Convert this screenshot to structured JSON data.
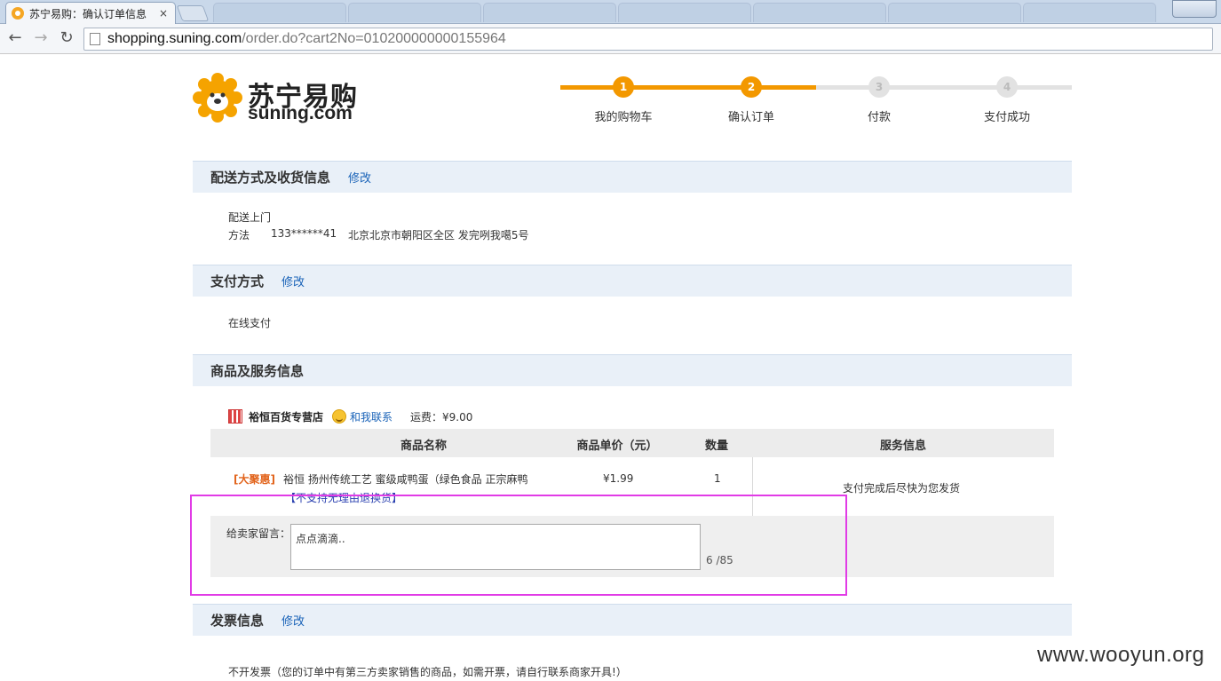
{
  "browser": {
    "tab_title": "苏宁易购：确认订单信息",
    "tab_close": "×",
    "url_host": "shopping.suning.com",
    "url_path": "/order.do?cart2No=010200000000155964",
    "back_glyph": "←",
    "forward_glyph": "→",
    "reload_glyph": "↻"
  },
  "logo": {
    "cn": "苏宁易购",
    "en": "suning.com"
  },
  "steps": [
    {
      "num": "1",
      "label": "我的购物车",
      "active": true
    },
    {
      "num": "2",
      "label": "确认订单",
      "active": true
    },
    {
      "num": "3",
      "label": "付款",
      "active": false
    },
    {
      "num": "4",
      "label": "支付成功",
      "active": false
    }
  ],
  "colors": {
    "accent": "#f39800",
    "inactive": "#e2e2e2",
    "link": "#1a63b8",
    "highlight": "#e13be6"
  },
  "delivery": {
    "title": "配送方式及收货信息",
    "edit": "修改",
    "method": "配送上门",
    "name": "方法",
    "phone": "133******41",
    "address": "北京北京市朝阳区全区  发完咧我噶5号"
  },
  "payment": {
    "title": "支付方式",
    "edit": "修改",
    "method": "在线支付"
  },
  "goods": {
    "title": "商品及服务信息",
    "store_name": "裕恒百货专营店",
    "contact": "和我联系",
    "shipping": "运费：¥9.00",
    "headers": {
      "name": "商品名称",
      "price": "商品单价（元）",
      "qty": "数量",
      "service": "服务信息"
    },
    "item": {
      "promo": "[大聚惠]",
      "name": "裕恒 扬州传统工艺 蜜级咸鸭蛋（绿色食品 正宗麻鸭",
      "note": "【不支持无理由退换货】",
      "price": "¥1.99",
      "qty": "1",
      "service": "支付完成后尽快为您发货"
    },
    "message": {
      "label": "给卖家留言：",
      "value": "点点滴滴..",
      "count": "6 /85"
    }
  },
  "invoice": {
    "title": "发票信息",
    "edit": "修改",
    "text": "不开发票（您的订单中有第三方卖家销售的商品，如需开票，请自行联系商家开具!）"
  },
  "watermark": "www.wooyun.org"
}
